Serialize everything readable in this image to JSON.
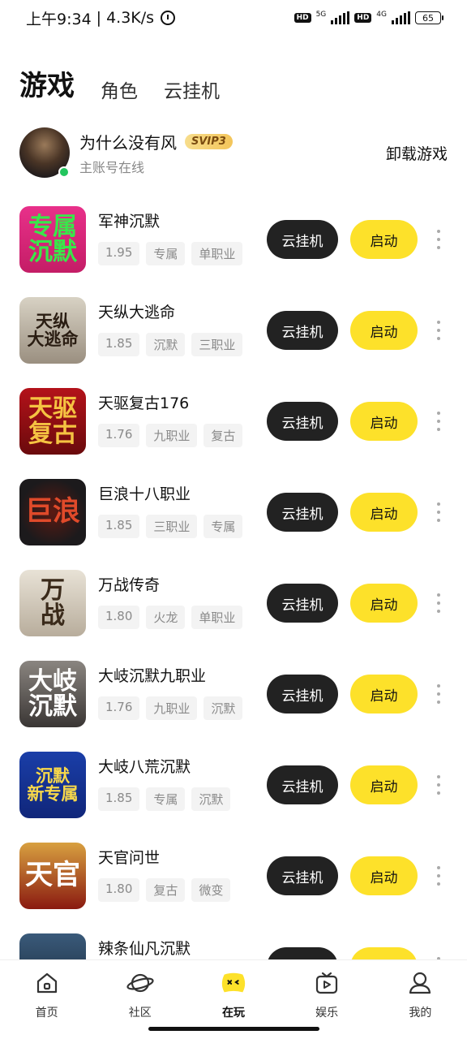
{
  "status_bar": {
    "time": "上午9:34",
    "speed": "4.3K/s",
    "hd1": "HD",
    "net1": "5G",
    "hd2": "HD",
    "net2": "4G",
    "battery": "65"
  },
  "tabs": [
    {
      "label": "游戏",
      "active": true
    },
    {
      "label": "角色",
      "active": false
    },
    {
      "label": "云挂机",
      "active": false
    }
  ],
  "account": {
    "name": "为什么没有风",
    "badge": "SVIP3",
    "status": "主账号在线",
    "uninstall_label": "卸载游戏"
  },
  "buttons": {
    "cloud": "云挂机",
    "start": "启动"
  },
  "games": [
    {
      "title": "军神沉默",
      "tags": [
        "1.95",
        "专属",
        "单职业"
      ],
      "icon_text": "专属\n沉默",
      "icon_bg": "linear-gradient(180deg,#e8308a,#c41d66)",
      "icon_color": "#38e84a"
    },
    {
      "title": "天纵大逃命",
      "tags": [
        "1.85",
        "沉默",
        "三职业"
      ],
      "icon_text": "天纵\n大逃命",
      "icon_bg": "linear-gradient(180deg,#d8d2c4,#9a8f80)",
      "icon_color": "#2a1d12"
    },
    {
      "title": "天驱复古176",
      "tags": [
        "1.76",
        "九职业",
        "复古"
      ],
      "icon_text": "天驱\n复古",
      "icon_bg": "linear-gradient(180deg,#b4121a,#6a0a0c)",
      "icon_color": "#f5c342"
    },
    {
      "title": "巨浪十八职业",
      "tags": [
        "1.85",
        "三职业",
        "专属"
      ],
      "icon_text": "巨浪",
      "icon_bg": "radial-gradient(circle,#5a1a12 0%,#1c1a1c 70%)",
      "icon_color": "#e04a2a"
    },
    {
      "title": "万战传奇",
      "tags": [
        "1.80",
        "火龙",
        "单职业"
      ],
      "icon_text": "万\n战",
      "icon_bg": "linear-gradient(180deg,#e8e2d6,#b8ad9c)",
      "icon_color": "#3a2a1a"
    },
    {
      "title": "大岐沉默九职业",
      "tags": [
        "1.76",
        "九职业",
        "沉默"
      ],
      "icon_text": "大岐\n沉默",
      "icon_bg": "linear-gradient(180deg,#8a8580,#3a3634)",
      "icon_color": "#ffffff"
    },
    {
      "title": "大岐八荒沉默",
      "tags": [
        "1.85",
        "专属",
        "沉默"
      ],
      "icon_text": "沉默\n新专属",
      "icon_bg": "linear-gradient(180deg,#1a3ea8,#10267a)",
      "icon_color": "#f8d84a"
    },
    {
      "title": "天官问世",
      "tags": [
        "1.80",
        "复古",
        "微变"
      ],
      "icon_text": "天官",
      "icon_bg": "linear-gradient(180deg,#d8a040,#8a1a10)",
      "icon_color": "#ffffff"
    },
    {
      "title": "辣条仙凡沉默",
      "tags": [],
      "icon_text": "",
      "icon_bg": "linear-gradient(180deg,#3a5a7a,#1a2a3a)",
      "icon_color": "#ffffff"
    }
  ],
  "nav": [
    {
      "label": "首页",
      "icon": "home-icon",
      "active": false
    },
    {
      "label": "社区",
      "icon": "planet-icon",
      "active": false
    },
    {
      "label": "在玩",
      "icon": "gamepad-icon",
      "active": true
    },
    {
      "label": "娱乐",
      "icon": "tv-icon",
      "active": false
    },
    {
      "label": "我的",
      "icon": "profile-icon",
      "active": false
    }
  ]
}
